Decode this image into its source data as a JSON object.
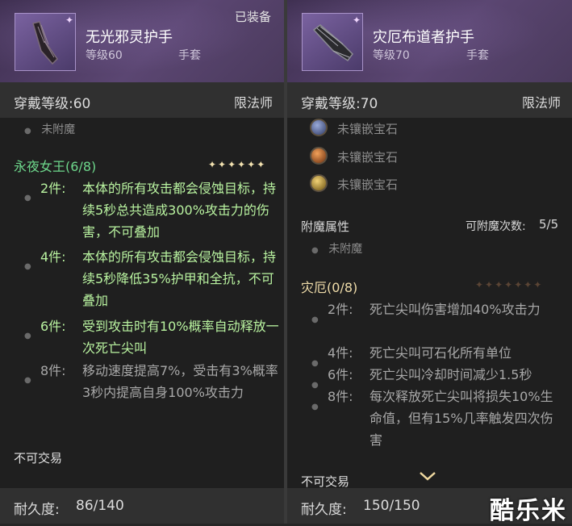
{
  "left": {
    "item_name": "无光邪灵护手",
    "item_level": "等级60",
    "item_slot": "手套",
    "equipped": "已装备",
    "req_label": "穿戴等级:60",
    "req_class": "限法师",
    "enchant": "未附魔",
    "set_title": "永夜女王(6/8)",
    "set_stars": "✦✦✦✦✦✦",
    "bonuses": [
      {
        "key": "2件:",
        "text": "本体的所有攻击都会侵蚀目标，持续5秒总共造成300%攻击力的伤害，不可叠加"
      },
      {
        "key": "4件:",
        "text": "本体的所有攻击都会侵蚀目标，持续5秒降低35%护甲和全抗，不可叠加"
      },
      {
        "key": "6件:",
        "text": "受到攻击时有10%概率自动释放一次死亡尖叫"
      },
      {
        "key": "8件:",
        "text": "移动速度提高7%，受击有3%概率3秒内提高自身100%攻击力"
      }
    ],
    "trade": "不可交易",
    "durability_label": "耐久度:",
    "durability_value": "86/140"
  },
  "right": {
    "item_name": "灾厄布道者护手",
    "item_level": "等级70",
    "item_slot": "手套",
    "req_label": "穿戴等级:70",
    "req_class": "限法师",
    "gems": [
      "未镶嵌宝石",
      "未镶嵌宝石",
      "未镶嵌宝石"
    ],
    "enchant_header": "附魔属性",
    "enchant_count_label": "可附魔次数:",
    "enchant_count": "5/5",
    "enchant": "未附魔",
    "set_title": "灾厄(0/8)",
    "set_stars": "✦✦✦✦✦✦✦",
    "bonuses": [
      {
        "key": "2件:",
        "text": "死亡尖叫伤害增加40%攻击力"
      },
      {
        "key": "4件:",
        "text": "死亡尖叫可石化所有单位"
      },
      {
        "key": "6件:",
        "text": "死亡尖叫冷却时间减少1.5秒"
      },
      {
        "key": "8件:",
        "text": "每次释放死亡尖叫将损失10%生命值，但有15%几率触发四次伤害"
      }
    ],
    "trade": "不可交易",
    "durability_label": "耐久度:",
    "durability_value": "150/150"
  },
  "watermark": "酷乐米",
  "colors": {
    "header_purple": "#5b4672",
    "set_green": "#6ed88c",
    "active_bonus": "#b9f3a0",
    "inactive_bonus": "#a8a8a8"
  }
}
